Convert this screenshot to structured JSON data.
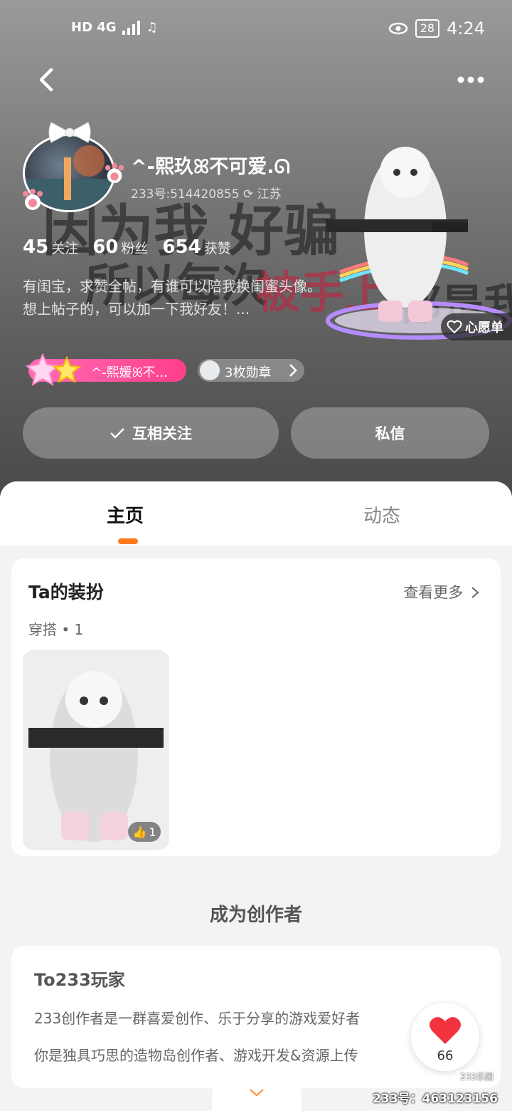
{
  "status_bar": {
    "network": "HD 4G",
    "battery": "28",
    "time": "4:24"
  },
  "profile": {
    "name": "^-熙玖ꕤ不可爱.ᘏ",
    "id_text": "233号:514420855",
    "location": "江苏",
    "stats": [
      {
        "value": "45",
        "label": "关注"
      },
      {
        "value": "60",
        "label": "粉丝"
      },
      {
        "value": "654",
        "label": "获赞"
      }
    ],
    "bio": "有闺宝，求赞全帖，有谁可以陪我换闺蜜头像。想上帖子的，可以加一下我好友！...",
    "badge_name": "^-熙媛ꕤ不...",
    "medals": "3枚勋章",
    "wishlist": "心愿单",
    "background_text": [
      "因为我 好骗",
      "所以每次",
      "被手上",
      "都是我"
    ]
  },
  "actions": {
    "follow": "互相关注",
    "message": "私信"
  },
  "tabs": [
    {
      "label": "主页"
    },
    {
      "label": "动态"
    }
  ],
  "outfit": {
    "title": "Ta的装扮",
    "see_more": "查看更多",
    "subtitle": "穿搭 • 1",
    "likes": "1"
  },
  "creator": {
    "section_title": "成为创作者",
    "card_title": "To233玩家",
    "line1": "233创作者是一群喜爱创作、乐于分享的游戏爱好者",
    "line2": "你是独具巧思的造物岛创作者、游戏开发&资源上传"
  },
  "float_like": {
    "count": "66"
  },
  "watermark": {
    "logo": "233乐园",
    "id": "233号：463123156"
  },
  "colors": {
    "accent": "#ff7a1a",
    "badge_pink": "#ff4f98",
    "like_red": "#f0333f"
  }
}
